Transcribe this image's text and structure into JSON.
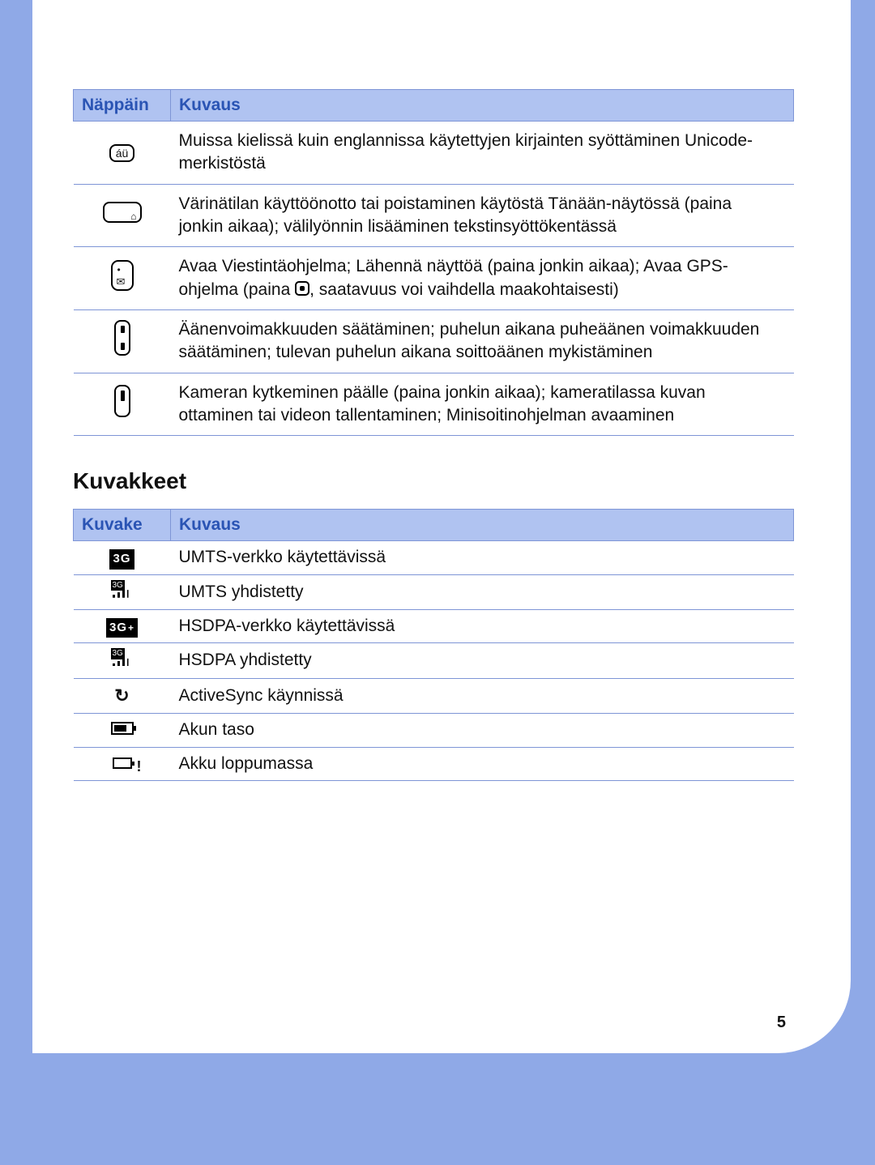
{
  "page_number": "5",
  "keys_table": {
    "header_key": "Näppäin",
    "header_desc": "Kuvaus",
    "rows": [
      {
        "icon": "au-key-icon",
        "icon_label": "áü",
        "desc": "Muissa kielissä kuin englannissa käytettyjen kirjainten syöttäminen Unicode-merkistöstä"
      },
      {
        "icon": "spacebar-key-icon",
        "desc": "Värinätilan käyttöönotto tai poistaminen käytöstä Tänään-näytössä (paina jonkin aikaa); välilyönnin lisääminen tekstinsyöttökentässä"
      },
      {
        "icon": "messaging-key-icon",
        "desc_pre": "Avaa Viestintäohjelma; Lähennä näyttöä (paina jonkin aikaa); Avaa GPS-ohjelma (paina ",
        "desc_post": ", saatavuus voi vaihdella maakohtaisesti)"
      },
      {
        "icon": "volume-key-icon",
        "desc": "Äänenvoimakkuuden säätäminen; puhelun aikana puheäänen voimakkuuden säätäminen; tulevan puhelun aikana soittoäänen mykistäminen"
      },
      {
        "icon": "camera-key-icon",
        "desc": "Kameran kytkeminen päälle (paina jonkin aikaa); kameratilassa kuvan ottaminen tai videon tallentaminen; Minisoitinohjelman avaaminen"
      }
    ]
  },
  "icons_section_title": "Kuvakkeet",
  "icons_table": {
    "header_icon": "Kuvake",
    "header_desc": "Kuvaus",
    "rows": [
      {
        "icon": "3g-icon",
        "desc": "UMTS-verkko käytettävissä"
      },
      {
        "icon": "3g-signal-icon",
        "desc": "UMTS yhdistetty"
      },
      {
        "icon": "3g-plus-icon",
        "desc": "HSDPA-verkko käytettävissä"
      },
      {
        "icon": "3g-plus-signal-icon",
        "desc": "HSDPA yhdistetty"
      },
      {
        "icon": "activesync-icon",
        "desc": "ActiveSync käynnissä"
      },
      {
        "icon": "battery-icon",
        "desc": "Akun taso"
      },
      {
        "icon": "battery-low-icon",
        "desc": "Akku loppumassa"
      }
    ]
  }
}
